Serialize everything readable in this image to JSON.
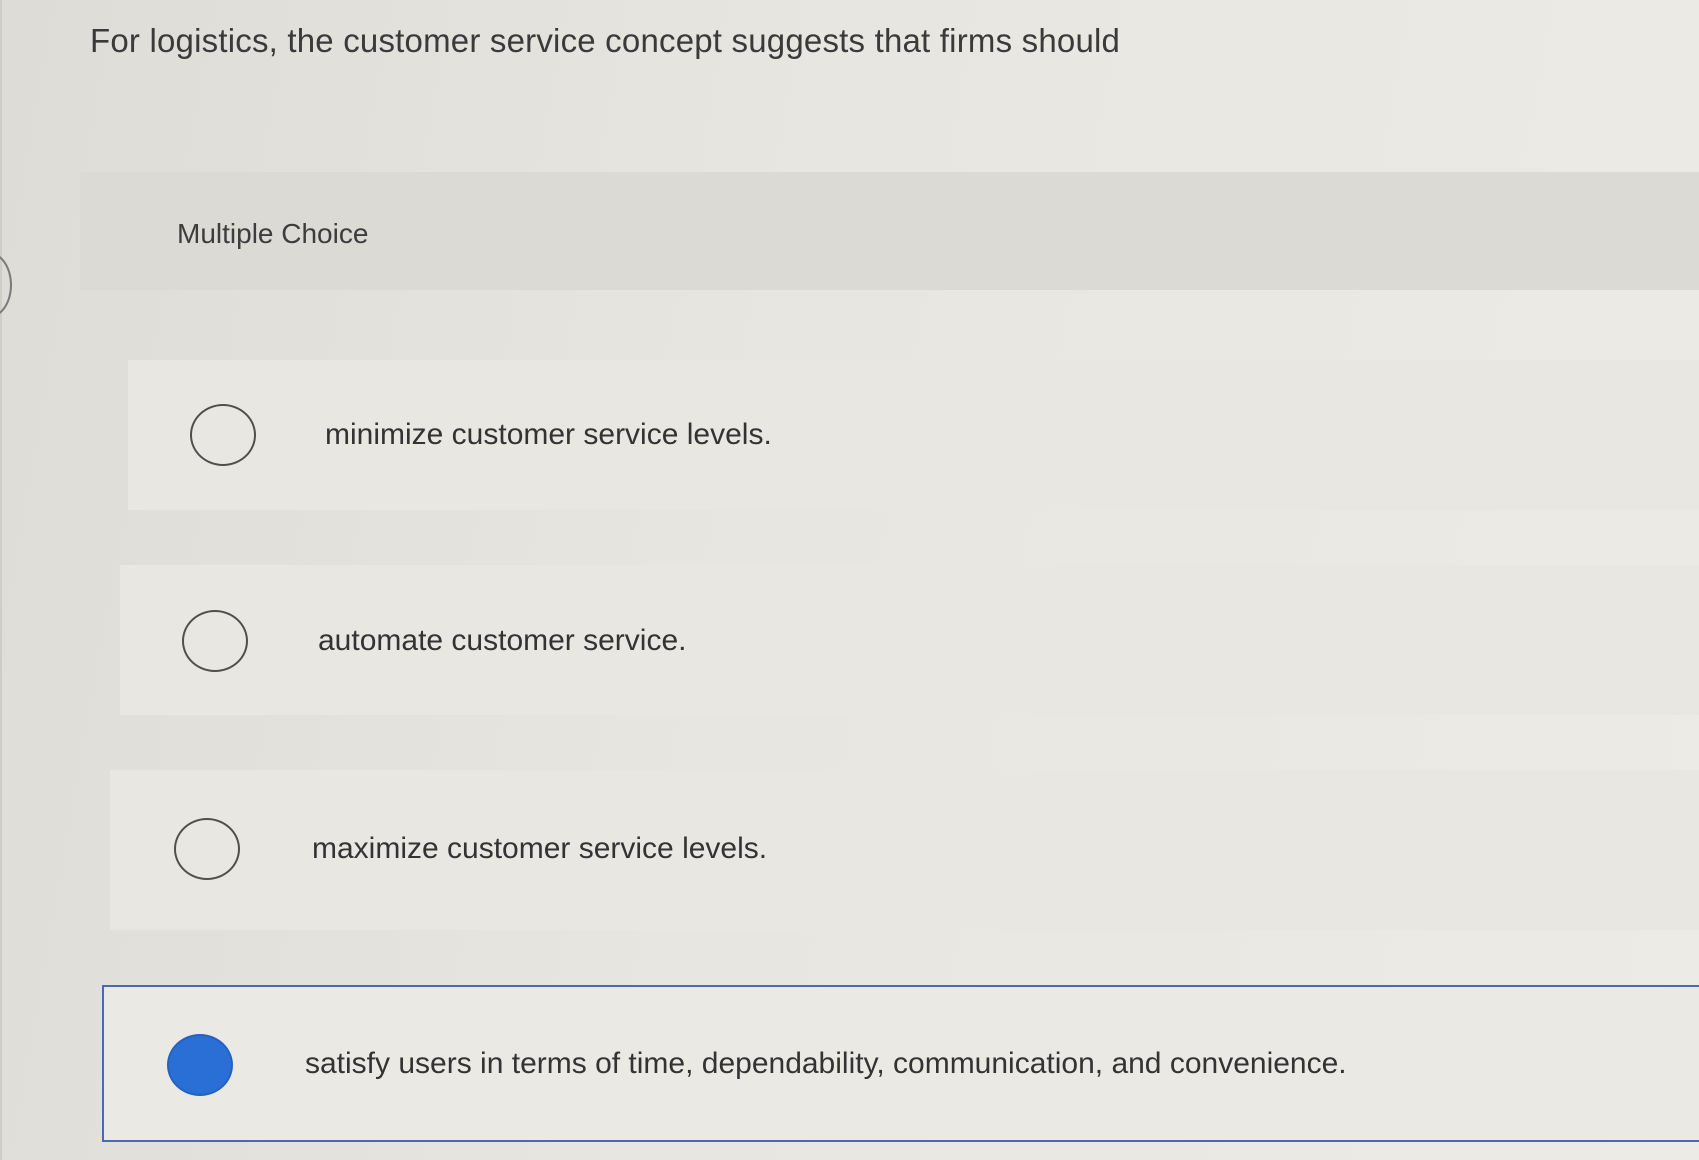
{
  "question": {
    "text": "For logistics, the customer service concept suggests that firms should"
  },
  "multiple_choice": {
    "label": "Multiple Choice"
  },
  "options": [
    {
      "text": "minimize customer service levels.",
      "selected": false
    },
    {
      "text": "automate customer service.",
      "selected": false
    },
    {
      "text": "maximize customer service levels.",
      "selected": false
    },
    {
      "text": "satisfy users in terms of time, dependability, communication, and convenience.",
      "selected": true
    }
  ],
  "colors": {
    "selected_radio": "#2a6fd6",
    "selected_border": "#4868b8",
    "background": "#e8e6e0"
  }
}
